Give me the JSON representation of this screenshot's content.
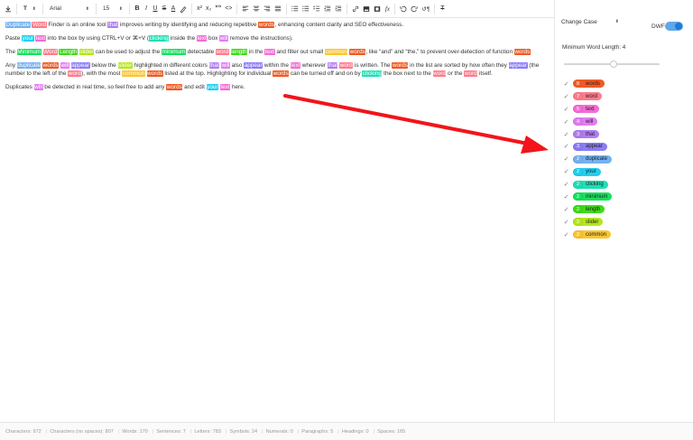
{
  "toolbar": {
    "font_family": "Arial",
    "font_size": "15",
    "heading_label": "T",
    "bold": "B",
    "italic": "I",
    "underline": "U",
    "strike": "S",
    "clear_format": "A",
    "superscript": "x²",
    "subscript": "x₂",
    "quote": "””",
    "code": "<>",
    "formula": "fx",
    "remove_format": "T"
  },
  "editor": {
    "paragraphs": [
      [
        {
          "t": "Duplicate",
          "c": "duplicate"
        },
        {
          "t": " "
        },
        {
          "t": "Word",
          "c": "word"
        },
        {
          "t": " Finder is an online tool "
        },
        {
          "t": "that",
          "c": "that"
        },
        {
          "t": " improves writing by identifying and reducing repetitive "
        },
        {
          "t": "words",
          "c": "words"
        },
        {
          "t": ", enhancing content clarity and SEO effectiveness."
        }
      ],
      [
        {
          "t": "Paste "
        },
        {
          "t": "your",
          "c": "your"
        },
        {
          "t": " "
        },
        {
          "t": "text",
          "c": "text"
        },
        {
          "t": " into the box by using CTRL+V or ⌘+V ("
        },
        {
          "t": "clicking",
          "c": "clicking"
        },
        {
          "t": " inside the "
        },
        {
          "t": "text",
          "c": "text"
        },
        {
          "t": " box "
        },
        {
          "t": "will",
          "c": "will"
        },
        {
          "t": " remove the instructions)."
        }
      ],
      [
        {
          "t": "The "
        },
        {
          "t": "Minimum",
          "c": "minimum"
        },
        {
          "t": " "
        },
        {
          "t": "Word",
          "c": "word"
        },
        {
          "t": " "
        },
        {
          "t": "Length",
          "c": "length"
        },
        {
          "t": " "
        },
        {
          "t": "slider",
          "c": "slider"
        },
        {
          "t": " can be used to adjust the "
        },
        {
          "t": "minimum",
          "c": "minimum"
        },
        {
          "t": " detectable "
        },
        {
          "t": "word",
          "c": "word"
        },
        {
          "t": " "
        },
        {
          "t": "length",
          "c": "length"
        },
        {
          "t": " in the "
        },
        {
          "t": "text",
          "c": "text"
        },
        {
          "t": " and filter out small "
        },
        {
          "t": "common",
          "c": "common"
        },
        {
          "t": " "
        },
        {
          "t": "words",
          "c": "words"
        },
        {
          "t": ", like “and” and “the,” to prevent over-detection of function "
        },
        {
          "t": "words",
          "c": "words"
        }
      ],
      [
        {
          "t": "Any "
        },
        {
          "t": "duplicate",
          "c": "duplicate"
        },
        {
          "t": " "
        },
        {
          "t": "words",
          "c": "words"
        },
        {
          "t": " "
        },
        {
          "t": "will",
          "c": "will"
        },
        {
          "t": " "
        },
        {
          "t": "appear",
          "c": "appear"
        },
        {
          "t": " below the "
        },
        {
          "t": "slider",
          "c": "slider"
        },
        {
          "t": " highlighted in different colors "
        },
        {
          "t": "that",
          "c": "that"
        },
        {
          "t": " "
        },
        {
          "t": "will",
          "c": "will"
        },
        {
          "t": " also "
        },
        {
          "t": "appear",
          "c": "appear"
        },
        {
          "t": " within the "
        },
        {
          "t": "text",
          "c": "text"
        },
        {
          "t": " wherever "
        },
        {
          "t": "that",
          "c": "that"
        },
        {
          "t": " "
        },
        {
          "t": "word",
          "c": "word"
        },
        {
          "t": " is written. The "
        },
        {
          "t": "words",
          "c": "words"
        },
        {
          "t": " in the list are sorted by how often they "
        },
        {
          "t": "appear",
          "c": "appear"
        },
        {
          "t": " (the number to the left of the "
        },
        {
          "t": "word",
          "c": "word"
        },
        {
          "t": "), with the most "
        },
        {
          "t": "common",
          "c": "common"
        },
        {
          "t": " "
        },
        {
          "t": "words",
          "c": "words"
        },
        {
          "t": " listed at the top. Highlighting for individual "
        },
        {
          "t": "words",
          "c": "words"
        },
        {
          "t": " can be turned off and on by "
        },
        {
          "t": "clicking",
          "c": "clicking"
        },
        {
          "t": " the box next to the "
        },
        {
          "t": "word",
          "c": "word"
        },
        {
          "t": " or the "
        },
        {
          "t": "word",
          "c": "word"
        },
        {
          "t": " itself."
        }
      ],
      [
        {
          "t": "Duplicates "
        },
        {
          "t": "will",
          "c": "will"
        },
        {
          "t": " be detected in real time, so feel free to add any "
        },
        {
          "t": "words",
          "c": "words"
        },
        {
          "t": " and edit "
        },
        {
          "t": "your",
          "c": "your"
        },
        {
          "t": " "
        },
        {
          "t": "text",
          "c": "text"
        },
        {
          "t": " here."
        }
      ]
    ]
  },
  "sidebar": {
    "case_select": "Change Case",
    "dwf_label": "DWF",
    "dwf_enabled": true,
    "min_length_label": "Minimum Word Length: 4",
    "min_length_value": 4,
    "words": [
      {
        "count": "8",
        "word": "words",
        "key": "words",
        "checked": true
      },
      {
        "count": "7",
        "word": "word",
        "key": "word",
        "checked": true
      },
      {
        "count": "5",
        "word": "text",
        "key": "text",
        "checked": true
      },
      {
        "count": "4",
        "word": "will",
        "key": "will",
        "checked": true
      },
      {
        "count": "3",
        "word": "that",
        "key": "that",
        "checked": true
      },
      {
        "count": "3",
        "word": "appear",
        "key": "appear",
        "checked": true
      },
      {
        "count": "2",
        "word": "duplicate",
        "key": "duplicate",
        "checked": true
      },
      {
        "count": "2",
        "word": "your",
        "key": "your",
        "checked": true
      },
      {
        "count": "2",
        "word": "clicking",
        "key": "clicking",
        "checked": true
      },
      {
        "count": "2",
        "word": "minimum",
        "key": "minimum",
        "checked": true
      },
      {
        "count": "2",
        "word": "length",
        "key": "length",
        "checked": true
      },
      {
        "count": "2",
        "word": "slider",
        "key": "slider",
        "checked": true
      },
      {
        "count": "2",
        "word": "common",
        "key": "common",
        "checked": true
      }
    ]
  },
  "status": [
    "Characters: 972",
    "Characters (no spaces): 807",
    "Words: 170",
    "Sentences: 7",
    "Letters: 783",
    "Symbols: 24",
    "Numerals: 0",
    "Paragraphs: 5",
    "Headings: 0",
    "Spaces: 165"
  ],
  "colors": {
    "accent": "#1f7ad8",
    "arrow": "#f2141a"
  }
}
